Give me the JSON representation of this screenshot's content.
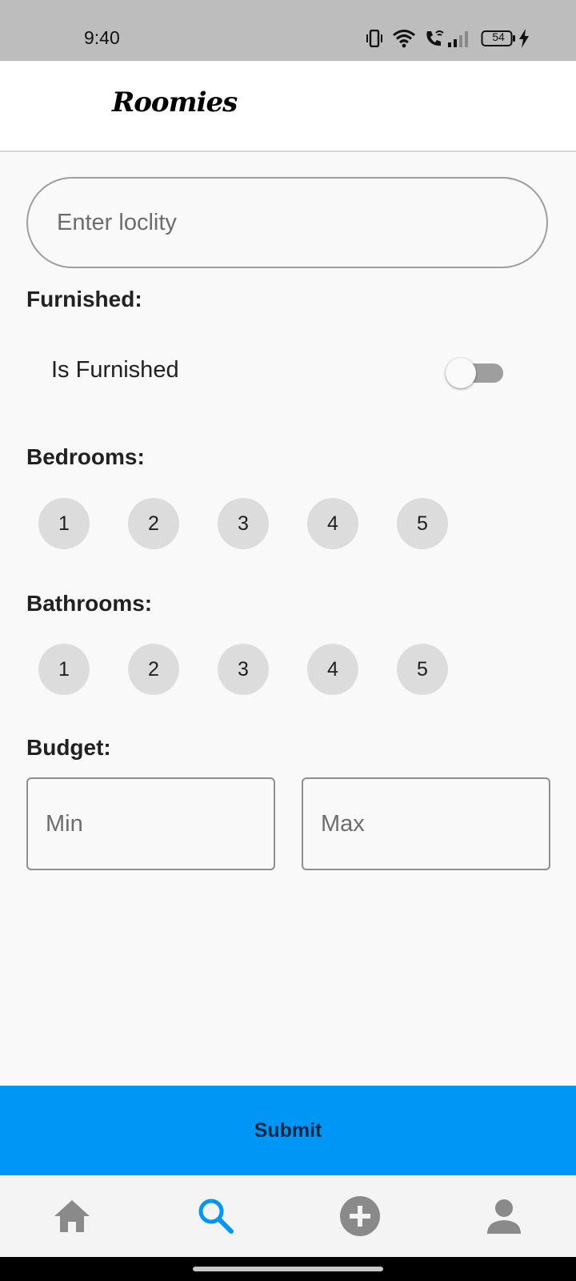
{
  "status_bar": {
    "time": "9:40",
    "battery": "54",
    "icons": [
      "vibrate-icon",
      "wifi-icon",
      "wifi-calling-icon",
      "signal-icon",
      "battery-icon",
      "charging-icon"
    ]
  },
  "app_bar": {
    "logo": "Roomies"
  },
  "search": {
    "placeholder": "Enter loclity",
    "value": ""
  },
  "furnished": {
    "label": "Furnished:",
    "option_label": "Is Furnished",
    "enabled": false
  },
  "bedrooms": {
    "label": "Bedrooms:",
    "options": [
      "1",
      "2",
      "3",
      "4",
      "5"
    ]
  },
  "bathrooms": {
    "label": "Bathrooms:",
    "options": [
      "1",
      "2",
      "3",
      "4",
      "5"
    ]
  },
  "budget": {
    "label": "Budget:",
    "min_placeholder": "Min",
    "max_placeholder": "Max"
  },
  "submit": {
    "label": "Submit"
  },
  "bottom_nav": {
    "items": [
      {
        "icon": "home-icon",
        "active": false
      },
      {
        "icon": "search-icon",
        "active": true
      },
      {
        "icon": "add-circle-icon",
        "active": false
      },
      {
        "icon": "profile-icon",
        "active": false
      }
    ]
  },
  "colors": {
    "accent": "#0096f5",
    "chip": "#dcdcdc",
    "nav_inactive": "#8a8a8a",
    "status_bar": "#bdbdbd"
  }
}
